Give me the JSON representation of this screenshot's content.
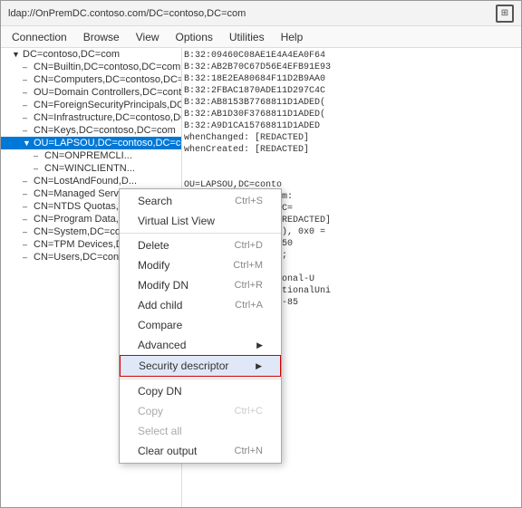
{
  "window": {
    "title": "ldap://OnPremDC.contoso.com/DC=contoso,DC=com",
    "screenshot_icon": "⊞"
  },
  "menubar": {
    "items": [
      "Connection",
      "Browse",
      "View",
      "Options",
      "Utilities",
      "Help"
    ]
  },
  "tree": {
    "root": "DC=contoso,DC=com",
    "items": [
      {
        "label": "CN=Builtin,DC=contoso,DC=com",
        "indent": 2,
        "expand": ""
      },
      {
        "label": "CN=Computers,DC=contoso,DC=com",
        "indent": 2,
        "expand": ""
      },
      {
        "label": "OU=Domain Controllers,DC=contoso,DC=com",
        "indent": 2,
        "expand": ""
      },
      {
        "label": "CN=ForeignSecurityPrincipals,DC=contoso,DC=",
        "indent": 2,
        "expand": ""
      },
      {
        "label": "CN=Infrastructure,DC=contoso,DC=com",
        "indent": 2,
        "expand": ""
      },
      {
        "label": "CN=Keys,DC=contoso,DC=com",
        "indent": 2,
        "expand": ""
      },
      {
        "label": "OU=LAPSOU,DC=contoso,DC=com",
        "indent": 2,
        "expand": "▼",
        "selected": true
      },
      {
        "label": "CN=ONPREMCLI...",
        "indent": 3,
        "expand": ""
      },
      {
        "label": "CN=WINCLIENTN...",
        "indent": 3,
        "expand": ""
      },
      {
        "label": "CN=LostAndFound,D...",
        "indent": 2,
        "expand": ""
      },
      {
        "label": "CN=Managed Servic...",
        "indent": 2,
        "expand": ""
      },
      {
        "label": "CN=NTDS Quotas,DC...",
        "indent": 2,
        "expand": ""
      },
      {
        "label": "CN=Program Data,DC...",
        "indent": 2,
        "expand": ""
      },
      {
        "label": "CN=System,DC=cont...",
        "indent": 2,
        "expand": ""
      },
      {
        "label": "CN=TPM Devices,DC...",
        "indent": 2,
        "expand": ""
      },
      {
        "label": "CN=Users,DC=conto...",
        "indent": 2,
        "expand": ""
      }
    ]
  },
  "right_pane": {
    "content": "B:32:09460C08AE1E4A4EA0F64\nB:32:AB2B70C67D56E4EFB91E93\nB:32:18E2EA80684F11D2B9AA0\nB:32:2FBAC1870ADE11D297C4C\nB:32:AB8153B7768811D1ADED(\nB:32:AB1D30F3768811D1ADED(\nB:32:A9D1CA15768811D1ADED\nwhenChanged: [REDACTED]\nwhenCreated: [REDACTED]\n\n\nOU=LAPSOU,DC=conto\nU,DC=contoso,DC=com:\ndName: OU=LAPSOU,DC=\nagationData (4): [REDACTED]\n:0 = ( ), 0x0 = ( ), 0x0 =\nP:/cn={B059B1C6-3E50\ne: 0x4 = ( WRITE );\nOU;\nory: CN=Organizational-U\n(2): top; organizationalUni\nab3f8c07-15f1-4c8e-85\n\nd: 28884;\n: 28703;\ned: [REDACTED]\nd: [REDACTED]"
  },
  "context_menu": {
    "items": [
      {
        "label": "Search",
        "shortcut": "Ctrl+S",
        "disabled": false,
        "submenu": false
      },
      {
        "label": "Virtual List View",
        "shortcut": "",
        "disabled": false,
        "submenu": false
      },
      {
        "separator": true
      },
      {
        "label": "Delete",
        "shortcut": "Ctrl+D",
        "disabled": false,
        "submenu": false
      },
      {
        "label": "Modify",
        "shortcut": "Ctrl+M",
        "disabled": false,
        "submenu": false
      },
      {
        "label": "Modify DN",
        "shortcut": "Ctrl+R",
        "disabled": false,
        "submenu": false
      },
      {
        "label": "Add child",
        "shortcut": "Ctrl+A",
        "disabled": false,
        "submenu": false
      },
      {
        "label": "Compare",
        "shortcut": "",
        "disabled": false,
        "submenu": false
      },
      {
        "label": "Advanced",
        "shortcut": "",
        "disabled": false,
        "submenu": true
      },
      {
        "label": "Security descriptor",
        "shortcut": "",
        "disabled": false,
        "submenu": true,
        "highlighted": true
      },
      {
        "separator": true
      },
      {
        "label": "Copy DN",
        "shortcut": "",
        "disabled": false,
        "submenu": false
      },
      {
        "label": "Copy",
        "shortcut": "Ctrl+C",
        "disabled": true,
        "submenu": false
      },
      {
        "label": "Select all",
        "shortcut": "",
        "disabled": true,
        "submenu": false
      },
      {
        "label": "Clear output",
        "shortcut": "Ctrl+N",
        "disabled": false,
        "submenu": false
      }
    ]
  }
}
